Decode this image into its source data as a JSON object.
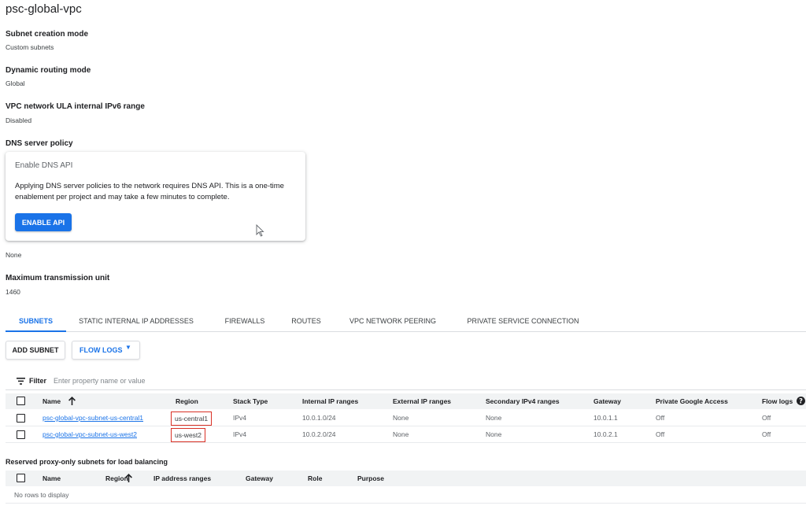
{
  "network": {
    "title": "psc-global-vpc"
  },
  "details": {
    "subnet_mode_label": "Subnet creation mode",
    "subnet_mode_value": "Custom subnets",
    "routing_label": "Dynamic routing mode",
    "routing_value": "Global",
    "ula_label": "VPC network ULA internal IPv6 range",
    "ula_value": "Disabled",
    "dns_label": "DNS server policy",
    "dns_value": "None",
    "mtu_label": "Maximum transmission unit",
    "mtu_value": "1460"
  },
  "dns_card": {
    "title": "Enable DNS API",
    "text": "Applying DNS server policies to the network requires DNS API. This is a one-time enablement per project and may take a few minutes to complete.",
    "button": "ENABLE API"
  },
  "tabs": [
    {
      "label": "SUBNETS",
      "active": true
    },
    {
      "label": "STATIC INTERNAL IP ADDRESSES"
    },
    {
      "label": "FIREWALLS"
    },
    {
      "label": "ROUTES"
    },
    {
      "label": "VPC NETWORK PEERING"
    },
    {
      "label": "PRIVATE SERVICE CONNECTION"
    }
  ],
  "toolbar": {
    "add_subnet": "ADD SUBNET",
    "flow_logs": "FLOW LOGS"
  },
  "filter": {
    "label": "Filter",
    "placeholder": "Enter property name or value"
  },
  "subnets_table": {
    "columns": [
      "Name",
      "Region",
      "Stack Type",
      "Internal IP ranges",
      "External IP ranges",
      "Secondary IPv4 ranges",
      "Gateway",
      "Private Google Access",
      "Flow logs"
    ],
    "rows": [
      [
        "psc-global-vpc-subnet-us-central1",
        "us-central1",
        "IPv4",
        "10.0.1.0/24",
        "None",
        "None",
        "10.0.1.1",
        "Off",
        "Off"
      ],
      [
        "psc-global-vpc-subnet-us-west2",
        "us-west2",
        "IPv4",
        "10.0.2.0/24",
        "None",
        "None",
        "10.0.2.1",
        "Off",
        "Off"
      ]
    ]
  },
  "proxy_section": {
    "title": "Reserved proxy-only subnets for load balancing",
    "columns": [
      "Name",
      "Region",
      "IP address ranges",
      "Gateway",
      "Role",
      "Purpose"
    ],
    "empty": "No rows to display"
  },
  "colors": {
    "accent": "#1a73e8",
    "highlight": "#d93025"
  }
}
